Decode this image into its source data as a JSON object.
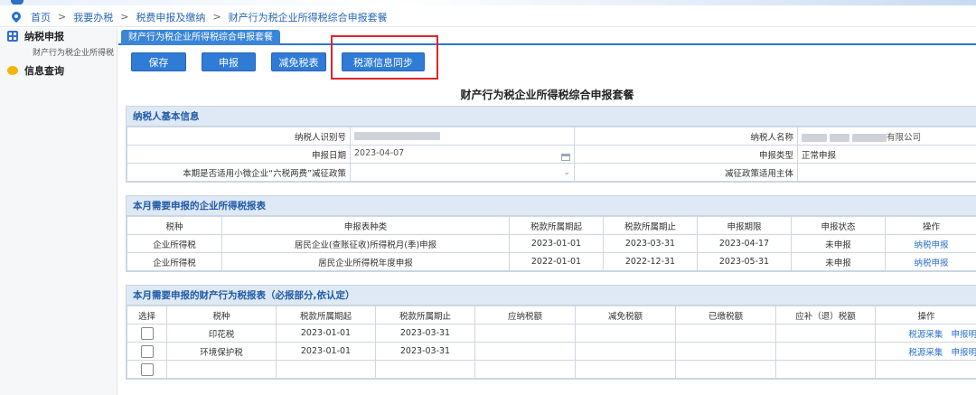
{
  "breadcrumb": {
    "items": [
      "首页",
      "我要办税",
      "税费申报及缴纳",
      "财产行为税企业所得税综合申报套餐"
    ],
    "separator": ">"
  },
  "sidebar": {
    "groups": [
      {
        "label": "纳税申报",
        "icon": "grid-icon",
        "items": [
          "财产行为税企业所得税"
        ]
      },
      {
        "label": "信息查询",
        "icon": "chat-icon",
        "items": []
      }
    ]
  },
  "tab": {
    "label": "财产行为税企业所得税综合申报套餐"
  },
  "toolbar": {
    "save": "保存",
    "report": "申报",
    "exempt": "减免税表",
    "sync": "税源信息同步"
  },
  "page_title": "财产行为税企业所得税综合申报套餐",
  "taxpayer": {
    "heading": "纳税人基本信息",
    "id_label": "纳税人识别号",
    "name_label": "纳税人名称",
    "name_suffix": "有限公司",
    "date_label": "申报日期",
    "date_value": "2023-04-07",
    "type_label": "申报类型",
    "type_value": "正常申报",
    "policy_label": "本期是否适用小微企业“六税两费”减征政策",
    "policy_value": "",
    "subject_label": "减征政策适用主体",
    "subject_value": ""
  },
  "income_tax": {
    "heading": "本月需要申报的企业所得税报表",
    "columns": [
      "税种",
      "申报表种类",
      "税款所属期起",
      "税款所属期止",
      "申报期限",
      "申报状态",
      "操作"
    ],
    "rows": [
      {
        "tax": "企业所得税",
        "form": "居民企业(查账征收)所得税月(季)申报",
        "start": "2023-01-01",
        "end": "2023-03-31",
        "deadline": "2023-04-17",
        "status": "未申报",
        "action": "纳税申报"
      },
      {
        "tax": "企业所得税",
        "form": "居民企业所得税年度申报",
        "start": "2022-01-01",
        "end": "2022-12-31",
        "deadline": "2023-05-31",
        "status": "未申报",
        "action": "纳税申报"
      }
    ]
  },
  "property_tax": {
    "heading": "本月需要申报的财产行为税报表（必报部分,依认定）",
    "columns": [
      "选择",
      "税种",
      "税款所属期起",
      "税款所属期止",
      "应纳税额",
      "减免税额",
      "已缴税额",
      "应补（退）税额",
      "操作"
    ],
    "rows": [
      {
        "tax": "印花税",
        "start": "2023-01-01",
        "end": "2023-03-31",
        "action1": "税源采集",
        "action2": "申报明"
      },
      {
        "tax": "环境保护税",
        "start": "2023-01-01",
        "end": "2023-03-31",
        "action1": "税源采集",
        "action2": "申报明"
      }
    ]
  },
  "colors": {
    "accent": "#2f7bd6",
    "highlight": "#e0252a",
    "section_bg": "#dfe9f5",
    "link": "#2a6fce"
  }
}
